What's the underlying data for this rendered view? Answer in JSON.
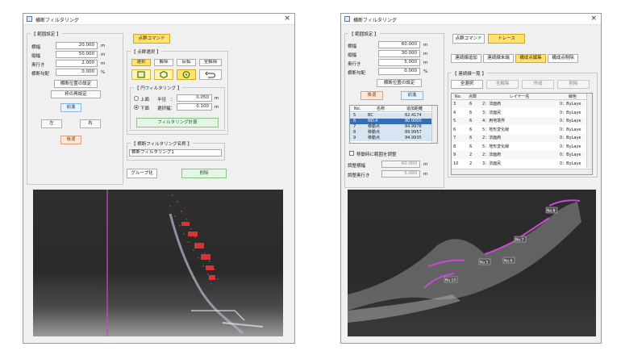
{
  "left": {
    "title": "横断フィルタリング",
    "range_group": "【 範囲設定 】",
    "fields": [
      {
        "label": "横幅",
        "value": "20.000",
        "unit": "m"
      },
      {
        "label": "縦幅",
        "value": "50.000",
        "unit": "m"
      },
      {
        "label": "奥行き",
        "value": "2.000",
        "unit": "m"
      },
      {
        "label": "横断勾配",
        "value": "0.000",
        "unit": "%"
      }
    ],
    "btn_station_set": "横断位置の設定",
    "btn_frame_reset": "枠の再設定",
    "btn_forward": "前進",
    "btn_left": "左",
    "btn_right": "右",
    "btn_back": "後退",
    "btn_point_command": "点群コマンド",
    "select_group": "【 点群選択 】",
    "sel_buttons": [
      "選択",
      "解除",
      "反転",
      "全解除"
    ],
    "circle_group": "【 円フィルタリング 】",
    "radio_top": "上面",
    "radio_bottom": "下面",
    "radius_label": "半径　：",
    "radius_value": "0.050",
    "radius_unit": "m",
    "select_width_label": "選択幅：",
    "select_width_value": "0.100",
    "select_width_unit": "m",
    "btn_filter_run": "フィルタリング計算",
    "name_group": "【 横断フィルタリング名称 】",
    "name_value": "横断フィルタリング1",
    "btn_group": "グループ化",
    "btn_delete": "削除"
  },
  "right": {
    "title": "横断フィルタリング",
    "range_group": "【 範囲設定 】",
    "fields": [
      {
        "label": "横幅",
        "value": "60.000",
        "unit": "m"
      },
      {
        "label": "縦幅",
        "value": "30.000",
        "unit": "m"
      },
      {
        "label": "奥行き",
        "value": "5.000",
        "unit": "m"
      },
      {
        "label": "横断勾配",
        "value": "0.000",
        "unit": "%"
      }
    ],
    "btn_station_set": "横断位置の設定",
    "btn_back": "後退",
    "btn_forward": "前進",
    "stations_table": {
      "headers": [
        "No.",
        "名称",
        "追加距離"
      ],
      "rows": [
        [
          "5",
          "BC",
          "62.4174"
        ],
        [
          "6",
          "NO.4",
          "80.0000"
        ],
        [
          "7",
          "移動点",
          "84.9978"
        ],
        [
          "8",
          "移動点",
          "89.9957"
        ],
        [
          "9",
          "移動点",
          "94.9935"
        ]
      ],
      "selected_index": 1
    },
    "chk_move_adjust": "移動時に範囲を調整",
    "adj_width_label": "調整横幅",
    "adj_width_value": "60.000",
    "adj_width_unit": "m",
    "adj_depth_label": "調整奥行き",
    "adj_depth_value": "5.000",
    "adj_depth_unit": "m",
    "btn_point_command": "点群コマンド",
    "btn_trace": "トレース",
    "line_buttons": [
      "連続線追加",
      "連続線末端",
      "構成点編集",
      "構成点削除"
    ],
    "line_group": "【 連続線一覧 】",
    "list_buttons": [
      "全選択",
      "全解除",
      "作成",
      "削除"
    ],
    "line_table": {
      "headers": [
        "No.",
        "点数",
        "レイヤー名",
        "線色"
      ],
      "rows": [
        [
          "3",
          "6",
          "2：法面肩",
          "0：ByLaye"
        ],
        [
          "4",
          "6",
          "3：法面尻",
          "0：ByLaye"
        ],
        [
          "5",
          "6",
          "4：用地境界",
          "0：ByLaye"
        ],
        [
          "6",
          "6",
          "5：地形変化線",
          "0：ByLaye"
        ],
        [
          "7",
          "6",
          "2：法面肩",
          "0：ByLaye"
        ],
        [
          "8",
          "6",
          "5：地形変化線",
          "0：ByLaye"
        ],
        [
          "9",
          "2",
          "2：法面肩",
          "0：ByLaye"
        ],
        [
          "10",
          "2",
          "3：法面尻",
          "0：ByLaye"
        ]
      ]
    },
    "canvas_labels": [
      "No.8",
      "No.7",
      "No.6",
      "No.5",
      "No.10"
    ],
    "close_icon": "×"
  },
  "colors": {
    "accent_yellow": "#ffe36e",
    "canvas_bg": "#2b2b2b",
    "points_red": "#d92c2c",
    "points_magenta": "#c84ad2"
  }
}
